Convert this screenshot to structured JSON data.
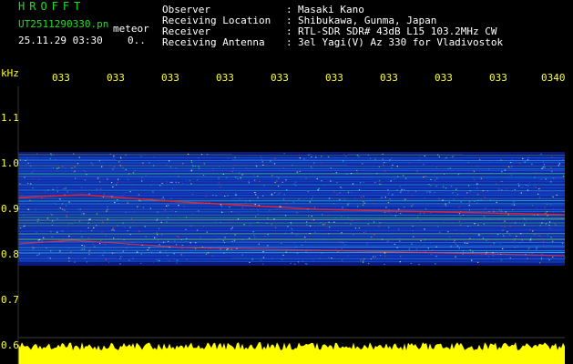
{
  "header": {
    "app_title": "HROFFT",
    "filename": "UT2511290330.pn",
    "mode": "meteor",
    "datetime": "25.11.29 03:30",
    "value": "0.."
  },
  "info": {
    "observer_label": "Observer",
    "observer_value": "Masaki Kano",
    "location_label": "Receiving Location",
    "location_value": "Shibukawa, Gunma, Japan",
    "receiver_label": "Receiver",
    "receiver_value": "RTL-SDR SDR# 43dB L15 103.2MHz CW",
    "antenna_label": "Receiving Antenna",
    "antenna_value": "3el Yagi(V) Az 330 for Vladivostok",
    "colon": ":"
  },
  "axis": {
    "freq_unit": "kHz",
    "freq_labels": [
      "1.1",
      "1.0",
      "0.9",
      "0.8",
      "0.7",
      "0.6"
    ],
    "time_labels": [
      "033",
      "033",
      "033",
      "033",
      "033",
      "033",
      "033",
      "033",
      "033",
      "0340"
    ]
  },
  "colors": {
    "background": "#000000",
    "header_green": "#22dd22",
    "label_yellow": "#ffff33",
    "text_white": "#ffffff",
    "baseline_yellow": "#ffff00",
    "meteor_red": "#ff2020"
  }
}
